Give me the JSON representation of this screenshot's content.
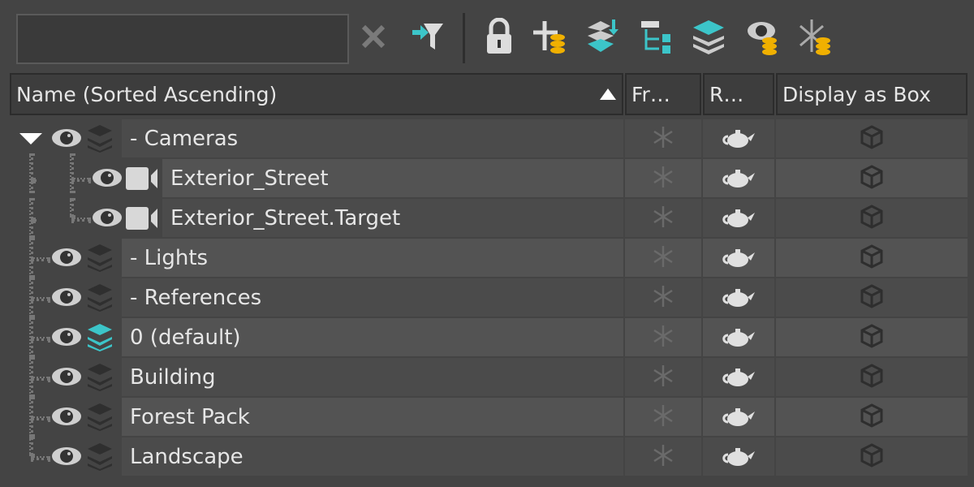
{
  "toolbar": {
    "search_value": "",
    "search_placeholder": "",
    "buttons": [
      {
        "name": "clear-search",
        "icon": "close-icon"
      },
      {
        "name": "filter",
        "icon": "filter-icon"
      },
      {
        "name": "lock-selection",
        "icon": "lock-icon"
      },
      {
        "name": "create-layer",
        "icon": "add-layer-icon"
      },
      {
        "name": "add-to-layer",
        "icon": "layers-add-icon"
      },
      {
        "name": "hierarchy",
        "icon": "hierarchy-icon"
      },
      {
        "name": "layers",
        "icon": "layers-icon"
      },
      {
        "name": "hide-layer",
        "icon": "eye-layer-icon"
      },
      {
        "name": "freeze-layer",
        "icon": "freeze-layer-icon"
      }
    ]
  },
  "columns": {
    "name": "Name (Sorted Ascending)",
    "frozen": "Fr…",
    "render": "R…",
    "display_box": "Display as Box",
    "sort": "ascending"
  },
  "accent": "#3cc5c9",
  "rows": [
    {
      "label": "- Cameras",
      "type": "layer",
      "level": 0,
      "expanded": true,
      "active": false
    },
    {
      "label": "Exterior_Street",
      "type": "camera",
      "level": 1
    },
    {
      "label": "Exterior_Street.Target",
      "type": "camera",
      "level": 1
    },
    {
      "label": "- Lights",
      "type": "layer",
      "level": 0,
      "active": false
    },
    {
      "label": "- References",
      "type": "layer",
      "level": 0,
      "active": false
    },
    {
      "label": "0 (default)",
      "type": "layer",
      "level": 0,
      "active": true
    },
    {
      "label": "Building",
      "type": "layer",
      "level": 0,
      "active": false
    },
    {
      "label": "Forest Pack",
      "type": "layer",
      "level": 0,
      "active": false
    },
    {
      "label": "Landscape",
      "type": "layer",
      "level": 0,
      "active": false
    }
  ]
}
